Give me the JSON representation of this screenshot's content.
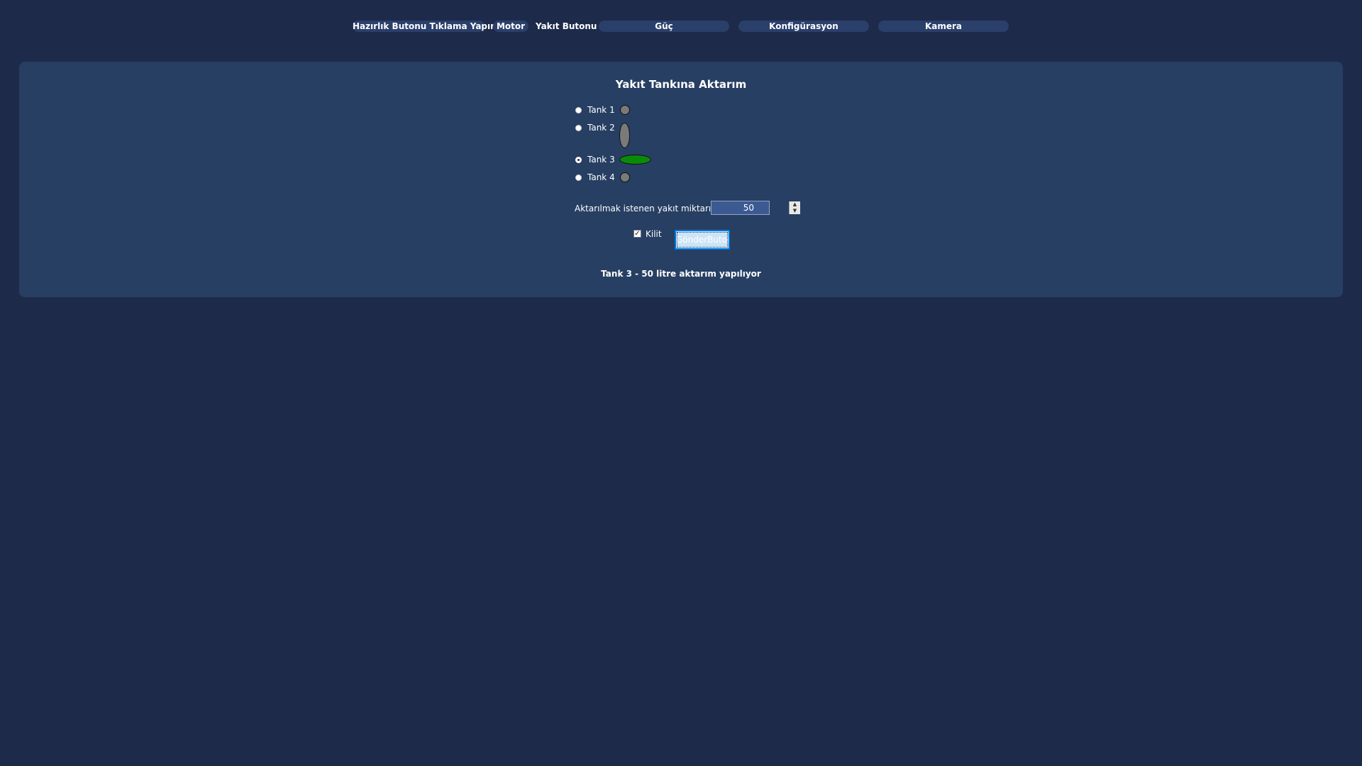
{
  "nav": {
    "items": [
      {
        "label": "Hazırlık Butonu Tıklama Yapınız"
      },
      {
        "label": "Motor"
      },
      {
        "label": "Yakıt Butonu"
      },
      {
        "label": "Güç"
      },
      {
        "label": "Konfigürasyon"
      },
      {
        "label": "Kamera"
      }
    ]
  },
  "panel": {
    "title": "Yakıt Tankına Aktarım",
    "tanks": [
      {
        "label": "Tank 1",
        "selected": false,
        "indicator_color": "#7a7a7a"
      },
      {
        "label": "Tank 2",
        "selected": false,
        "indicator_color": "#7a7a7a"
      },
      {
        "label": "Tank 3",
        "selected": true,
        "indicator_color": "#0a8a0a"
      },
      {
        "label": "Tank 4",
        "selected": false,
        "indicator_color": "#7a7a7a"
      }
    ],
    "amount_label": "Aktarılmak istenen yakıt miktarı(lt):",
    "amount_value": "50",
    "lock_label": "Kilit",
    "lock_checked": true,
    "send_label": "GönderButonu",
    "status": "Tank 3 - 50 litre aktarım yapılıyor"
  },
  "colors": {
    "background": "#1e2a4a",
    "panel": "#273f63",
    "nav_pill": "#2b3f6b",
    "selected_indicator": "#0a8a0a",
    "inactive_indicator": "#7a7a7a"
  }
}
